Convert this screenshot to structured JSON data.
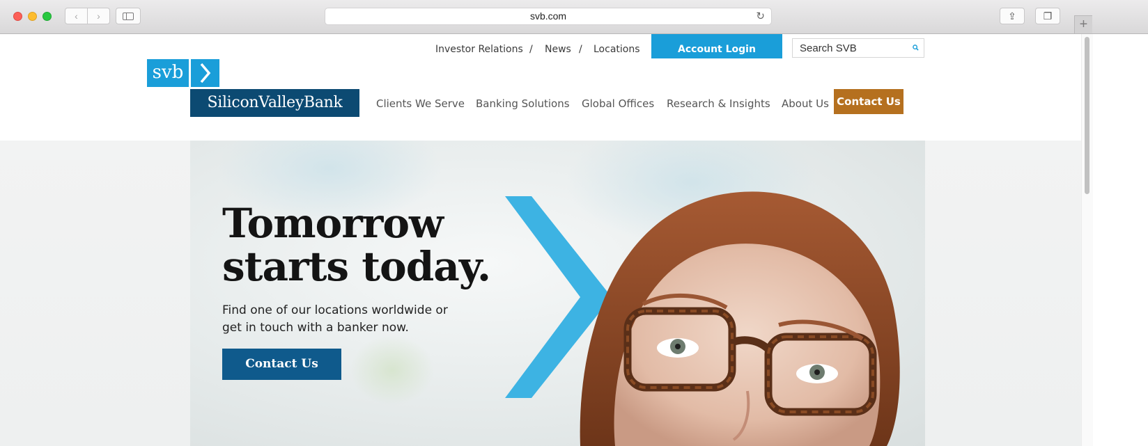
{
  "browser": {
    "url": "svb.com",
    "new_tab_symbol": "+",
    "back_symbol": "‹",
    "forward_symbol": "›",
    "reload_symbol": "↻",
    "share_symbol": "⇪",
    "tabs_symbol": "❐"
  },
  "utility_nav": {
    "links": [
      "Investor Relations",
      "News",
      "Locations"
    ],
    "separator": "/",
    "account_login": "Account Login",
    "search_placeholder": "Search SVB"
  },
  "logo": {
    "short": "svb",
    "name": "SiliconValleyBank"
  },
  "main_nav": {
    "items": [
      "Clients We Serve",
      "Banking Solutions",
      "Global Offices",
      "Research & Insights",
      "About Us"
    ],
    "contact": "Contact Us"
  },
  "hero": {
    "title_line1": "Tomorrow",
    "title_line2": "starts today.",
    "subtitle_line1": "Find one of our locations worldwide or",
    "subtitle_line2": "get in touch with a banker now.",
    "button": "Contact Us"
  },
  "colors": {
    "accent_blue": "#1a9ed9",
    "navy": "#0c4a72",
    "contact_orange": "#b5701f",
    "hero_button": "#0f5a8c"
  }
}
